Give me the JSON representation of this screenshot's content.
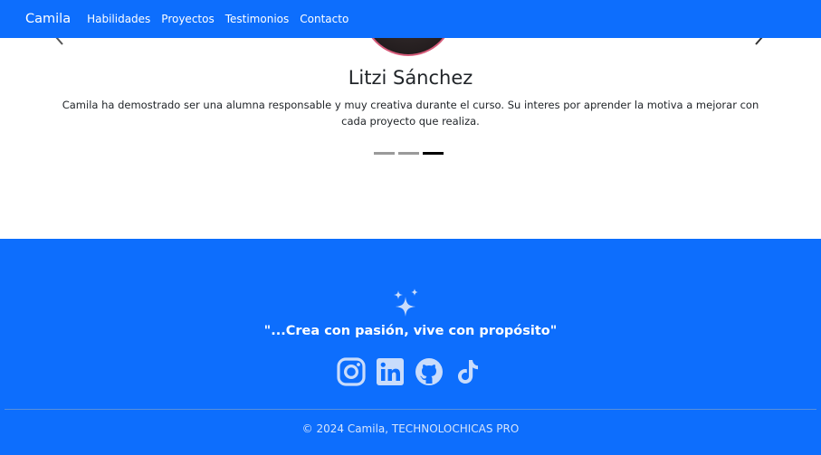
{
  "navbar": {
    "brand": "Camila",
    "links": [
      "Habilidades",
      "Proyectos",
      "Testimonios",
      "Contacto"
    ]
  },
  "testimonial": {
    "name": "Litzi Sánchez",
    "quote": "Camila ha demostrado ser una alumna responsable y muy creativa durante el curso. Su interes por aprender la motiva a mejorar con cada proyecto que realiza.",
    "prev_icon": "chevron-left-icon",
    "next_icon": "chevron-right-icon",
    "slides_total": 3,
    "active_slide": 3
  },
  "footer": {
    "sparkle_icon": "stars-icon",
    "motto": "\"...Crea con pasión, vive con propósito\"",
    "socials": [
      "instagram-icon",
      "linkedin-icon",
      "github-icon",
      "tiktok-icon"
    ],
    "copyright": "© 2024 Camila, TECHNOLOCHICAS PRO"
  },
  "colors": {
    "primary": "#0d6efd",
    "icon_light": "#c9dcfb",
    "indicator_active": "#000000",
    "indicator_inactive": "#9a9a9a"
  }
}
